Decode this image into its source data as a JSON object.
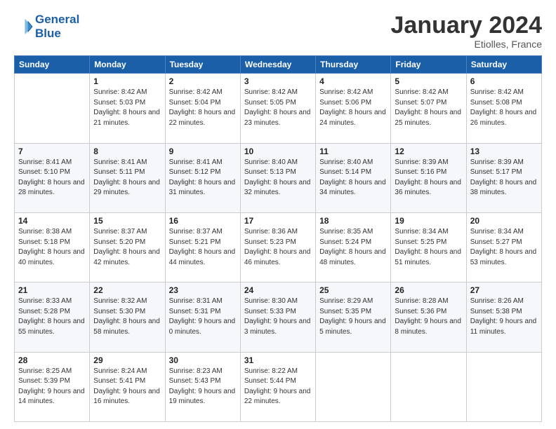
{
  "header": {
    "logo_line1": "General",
    "logo_line2": "Blue",
    "month": "January 2024",
    "location": "Etiolles, France"
  },
  "days_of_week": [
    "Sunday",
    "Monday",
    "Tuesday",
    "Wednesday",
    "Thursday",
    "Friday",
    "Saturday"
  ],
  "weeks": [
    [
      {
        "day": "",
        "sunrise": "",
        "sunset": "",
        "daylight": ""
      },
      {
        "day": "1",
        "sunrise": "Sunrise: 8:42 AM",
        "sunset": "Sunset: 5:03 PM",
        "daylight": "Daylight: 8 hours and 21 minutes."
      },
      {
        "day": "2",
        "sunrise": "Sunrise: 8:42 AM",
        "sunset": "Sunset: 5:04 PM",
        "daylight": "Daylight: 8 hours and 22 minutes."
      },
      {
        "day": "3",
        "sunrise": "Sunrise: 8:42 AM",
        "sunset": "Sunset: 5:05 PM",
        "daylight": "Daylight: 8 hours and 23 minutes."
      },
      {
        "day": "4",
        "sunrise": "Sunrise: 8:42 AM",
        "sunset": "Sunset: 5:06 PM",
        "daylight": "Daylight: 8 hours and 24 minutes."
      },
      {
        "day": "5",
        "sunrise": "Sunrise: 8:42 AM",
        "sunset": "Sunset: 5:07 PM",
        "daylight": "Daylight: 8 hours and 25 minutes."
      },
      {
        "day": "6",
        "sunrise": "Sunrise: 8:42 AM",
        "sunset": "Sunset: 5:08 PM",
        "daylight": "Daylight: 8 hours and 26 minutes."
      }
    ],
    [
      {
        "day": "7",
        "sunrise": "Sunrise: 8:41 AM",
        "sunset": "Sunset: 5:10 PM",
        "daylight": "Daylight: 8 hours and 28 minutes."
      },
      {
        "day": "8",
        "sunrise": "Sunrise: 8:41 AM",
        "sunset": "Sunset: 5:11 PM",
        "daylight": "Daylight: 8 hours and 29 minutes."
      },
      {
        "day": "9",
        "sunrise": "Sunrise: 8:41 AM",
        "sunset": "Sunset: 5:12 PM",
        "daylight": "Daylight: 8 hours and 31 minutes."
      },
      {
        "day": "10",
        "sunrise": "Sunrise: 8:40 AM",
        "sunset": "Sunset: 5:13 PM",
        "daylight": "Daylight: 8 hours and 32 minutes."
      },
      {
        "day": "11",
        "sunrise": "Sunrise: 8:40 AM",
        "sunset": "Sunset: 5:14 PM",
        "daylight": "Daylight: 8 hours and 34 minutes."
      },
      {
        "day": "12",
        "sunrise": "Sunrise: 8:39 AM",
        "sunset": "Sunset: 5:16 PM",
        "daylight": "Daylight: 8 hours and 36 minutes."
      },
      {
        "day": "13",
        "sunrise": "Sunrise: 8:39 AM",
        "sunset": "Sunset: 5:17 PM",
        "daylight": "Daylight: 8 hours and 38 minutes."
      }
    ],
    [
      {
        "day": "14",
        "sunrise": "Sunrise: 8:38 AM",
        "sunset": "Sunset: 5:18 PM",
        "daylight": "Daylight: 8 hours and 40 minutes."
      },
      {
        "day": "15",
        "sunrise": "Sunrise: 8:37 AM",
        "sunset": "Sunset: 5:20 PM",
        "daylight": "Daylight: 8 hours and 42 minutes."
      },
      {
        "day": "16",
        "sunrise": "Sunrise: 8:37 AM",
        "sunset": "Sunset: 5:21 PM",
        "daylight": "Daylight: 8 hours and 44 minutes."
      },
      {
        "day": "17",
        "sunrise": "Sunrise: 8:36 AM",
        "sunset": "Sunset: 5:23 PM",
        "daylight": "Daylight: 8 hours and 46 minutes."
      },
      {
        "day": "18",
        "sunrise": "Sunrise: 8:35 AM",
        "sunset": "Sunset: 5:24 PM",
        "daylight": "Daylight: 8 hours and 48 minutes."
      },
      {
        "day": "19",
        "sunrise": "Sunrise: 8:34 AM",
        "sunset": "Sunset: 5:25 PM",
        "daylight": "Daylight: 8 hours and 51 minutes."
      },
      {
        "day": "20",
        "sunrise": "Sunrise: 8:34 AM",
        "sunset": "Sunset: 5:27 PM",
        "daylight": "Daylight: 8 hours and 53 minutes."
      }
    ],
    [
      {
        "day": "21",
        "sunrise": "Sunrise: 8:33 AM",
        "sunset": "Sunset: 5:28 PM",
        "daylight": "Daylight: 8 hours and 55 minutes."
      },
      {
        "day": "22",
        "sunrise": "Sunrise: 8:32 AM",
        "sunset": "Sunset: 5:30 PM",
        "daylight": "Daylight: 8 hours and 58 minutes."
      },
      {
        "day": "23",
        "sunrise": "Sunrise: 8:31 AM",
        "sunset": "Sunset: 5:31 PM",
        "daylight": "Daylight: 9 hours and 0 minutes."
      },
      {
        "day": "24",
        "sunrise": "Sunrise: 8:30 AM",
        "sunset": "Sunset: 5:33 PM",
        "daylight": "Daylight: 9 hours and 3 minutes."
      },
      {
        "day": "25",
        "sunrise": "Sunrise: 8:29 AM",
        "sunset": "Sunset: 5:35 PM",
        "daylight": "Daylight: 9 hours and 5 minutes."
      },
      {
        "day": "26",
        "sunrise": "Sunrise: 8:28 AM",
        "sunset": "Sunset: 5:36 PM",
        "daylight": "Daylight: 9 hours and 8 minutes."
      },
      {
        "day": "27",
        "sunrise": "Sunrise: 8:26 AM",
        "sunset": "Sunset: 5:38 PM",
        "daylight": "Daylight: 9 hours and 11 minutes."
      }
    ],
    [
      {
        "day": "28",
        "sunrise": "Sunrise: 8:25 AM",
        "sunset": "Sunset: 5:39 PM",
        "daylight": "Daylight: 9 hours and 14 minutes."
      },
      {
        "day": "29",
        "sunrise": "Sunrise: 8:24 AM",
        "sunset": "Sunset: 5:41 PM",
        "daylight": "Daylight: 9 hours and 16 minutes."
      },
      {
        "day": "30",
        "sunrise": "Sunrise: 8:23 AM",
        "sunset": "Sunset: 5:43 PM",
        "daylight": "Daylight: 9 hours and 19 minutes."
      },
      {
        "day": "31",
        "sunrise": "Sunrise: 8:22 AM",
        "sunset": "Sunset: 5:44 PM",
        "daylight": "Daylight: 9 hours and 22 minutes."
      },
      {
        "day": "",
        "sunrise": "",
        "sunset": "",
        "daylight": ""
      },
      {
        "day": "",
        "sunrise": "",
        "sunset": "",
        "daylight": ""
      },
      {
        "day": "",
        "sunrise": "",
        "sunset": "",
        "daylight": ""
      }
    ]
  ]
}
